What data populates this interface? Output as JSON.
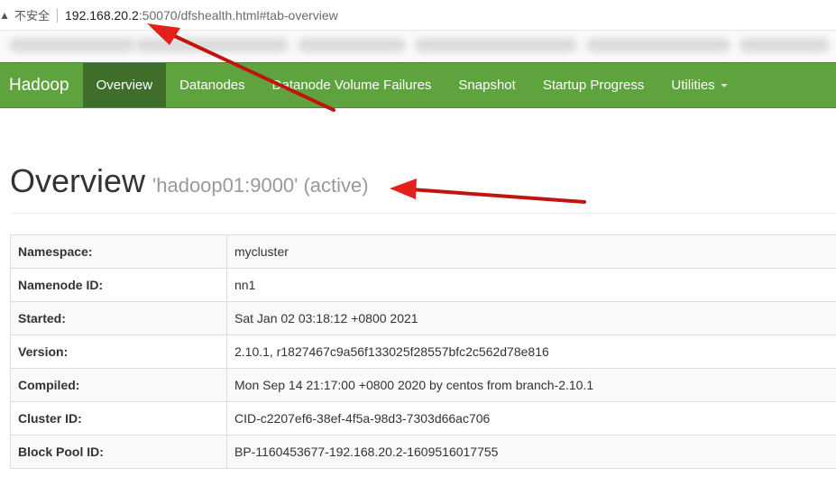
{
  "address_bar": {
    "security_label": "不安全",
    "url_host": "192.168.20.2",
    "url_rest": ":50070/dfshealth.html#tab-overview"
  },
  "navbar": {
    "brand": "Hadoop",
    "items": [
      {
        "label": "Overview",
        "active": true
      },
      {
        "label": "Datanodes"
      },
      {
        "label": "Datanode Volume Failures"
      },
      {
        "label": "Snapshot"
      },
      {
        "label": "Startup Progress"
      },
      {
        "label": "Utilities",
        "dropdown": true
      }
    ]
  },
  "header": {
    "title": "Overview",
    "subtitle": "'hadoop01:9000' (active)"
  },
  "info_table": [
    {
      "label": "Namespace:",
      "value": "mycluster"
    },
    {
      "label": "Namenode ID:",
      "value": "nn1"
    },
    {
      "label": "Started:",
      "value": "Sat Jan 02 03:18:12 +0800 2021"
    },
    {
      "label": "Version:",
      "value": "2.10.1, r1827467c9a56f133025f28557bfc2c562d78e816"
    },
    {
      "label": "Compiled:",
      "value": "Mon Sep 14 21:17:00 +0800 2020 by centos from branch-2.10.1"
    },
    {
      "label": "Cluster ID:",
      "value": "CID-c2207ef6-38ef-4f5a-98d3-7303d66ac706"
    },
    {
      "label": "Block Pool ID:",
      "value": "BP-1160453677-192.168.20.2-1609516017755"
    }
  ],
  "colors": {
    "navbar": "#5fa33e",
    "navbar_active": "#3f6e2a",
    "annotation_arrow": "#e3201b"
  }
}
